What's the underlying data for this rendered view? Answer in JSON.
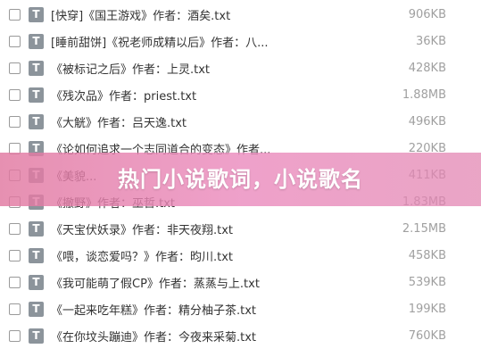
{
  "files": [
    {
      "name": "[快穿]《国王游戏》作者：酒矣.txt",
      "size": "906KB"
    },
    {
      "name": "[睡前甜饼]《祝老师成精以后》作者：八...",
      "size": "36KB"
    },
    {
      "name": "《被标记之后》作者：上灵.txt",
      "size": "428KB"
    },
    {
      "name": "《残次品》作者：priest.txt",
      "size": "1.88MB"
    },
    {
      "name": "《大觥》作者：吕天逸.txt",
      "size": "496KB"
    },
    {
      "name": "《论如何追求一个志同道合的变态》作者...",
      "size": "220KB"
    },
    {
      "name": "《美貌...",
      "size": "411KB"
    },
    {
      "name": "《撤野》作者：巫哲.txt",
      "size": "1.83MB"
    },
    {
      "name": "《天宝伏妖录》作者：非天夜翔.txt",
      "size": "2.15MB"
    },
    {
      "name": "《喂，谈恋爱吗？》作者：昀川.txt",
      "size": "458KB"
    },
    {
      "name": "《我可能萌了假CP》作者：蒸蒸与上.txt",
      "size": "539KB"
    },
    {
      "name": "《一起来吃年糕》作者：精分柚子茶.txt",
      "size": "199KB"
    },
    {
      "name": "《在你坟头蹦迪》作者：今夜来采菊.txt",
      "size": "760KB"
    }
  ],
  "file_icon_letter": "T",
  "banner": {
    "text": "热门小说歌词，小说歌名"
  }
}
